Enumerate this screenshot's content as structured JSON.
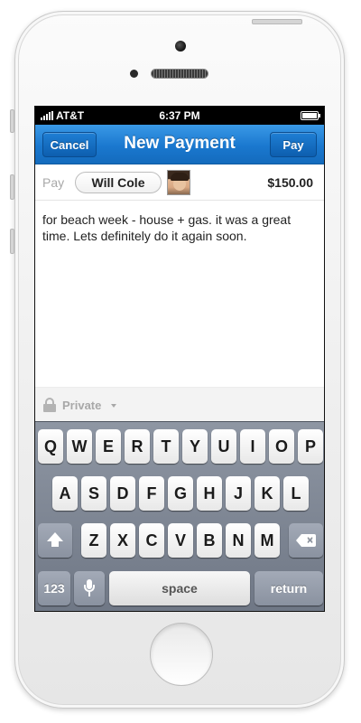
{
  "status_bar": {
    "carrier": "AT&T",
    "time": "6:37 PM",
    "signal_icon": "signal-bars-icon",
    "battery_icon": "battery-full-icon"
  },
  "nav": {
    "cancel_label": "Cancel",
    "title": "New Payment",
    "pay_label": "Pay"
  },
  "payment": {
    "pay_label": "Pay",
    "recipient": "Will Cole",
    "amount": "$150.00",
    "note": "for beach week - house + gas. it was a great time. Lets definitely do it again soon.",
    "privacy": "Private"
  },
  "keyboard": {
    "row1": [
      "Q",
      "W",
      "E",
      "R",
      "T",
      "Y",
      "U",
      "I",
      "O",
      "P"
    ],
    "row2": [
      "A",
      "S",
      "D",
      "F",
      "G",
      "H",
      "J",
      "K",
      "L"
    ],
    "row3": [
      "Z",
      "X",
      "C",
      "V",
      "B",
      "N",
      "M"
    ],
    "numbers_label": "123",
    "space_label": "space",
    "return_label": "return"
  },
  "colors": {
    "nav_blue": "#1a78cf",
    "keyboard_bg": "#7f8794"
  }
}
